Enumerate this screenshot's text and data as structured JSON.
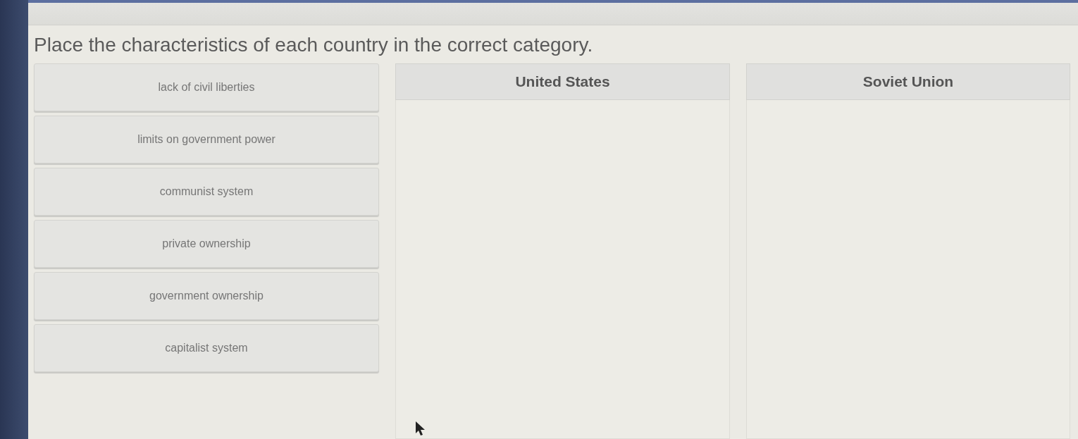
{
  "instruction": "Place the characteristics of each country in the correct category.",
  "items": [
    {
      "label": "lack of civil liberties"
    },
    {
      "label": "limits on government power"
    },
    {
      "label": "communist system"
    },
    {
      "label": "private ownership"
    },
    {
      "label": "government ownership"
    },
    {
      "label": "capitalist system"
    }
  ],
  "categories": [
    {
      "title": "United States"
    },
    {
      "title": "Soviet Union"
    }
  ]
}
